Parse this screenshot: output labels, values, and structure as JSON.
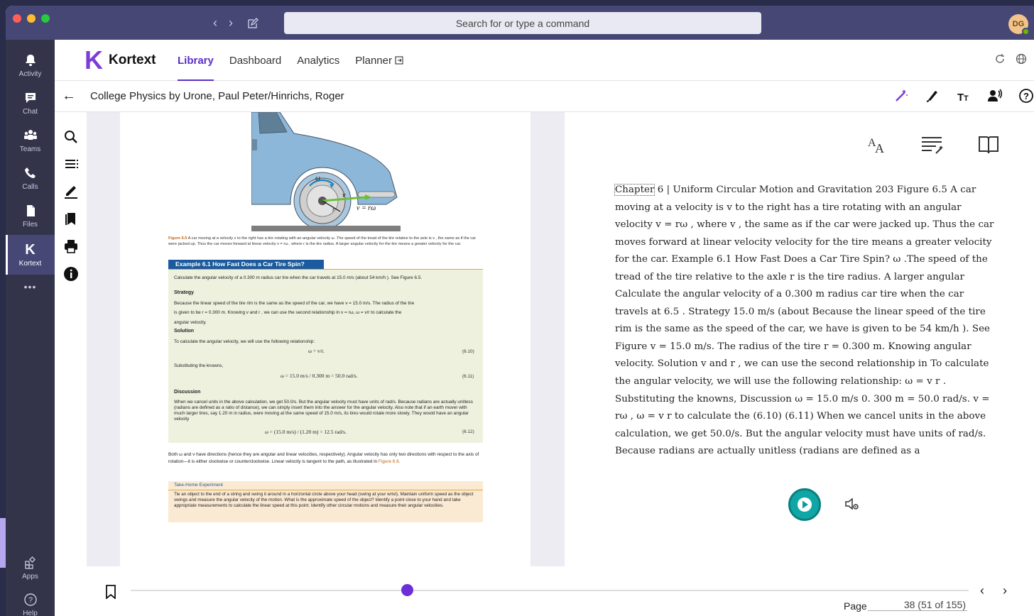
{
  "titlebar": {
    "search_placeholder": "Search for or type a command",
    "avatar_initials": "DG",
    "dot_colors": [
      "#ff5f57",
      "#ffbd2e",
      "#28c840"
    ]
  },
  "rail": {
    "items": [
      {
        "label": "Activity",
        "icon": "bell-icon"
      },
      {
        "label": "Chat",
        "icon": "chat-icon"
      },
      {
        "label": "Teams",
        "icon": "teams-icon"
      },
      {
        "label": "Calls",
        "icon": "phone-icon"
      },
      {
        "label": "Files",
        "icon": "file-icon"
      },
      {
        "label": "Kortext",
        "icon": "kortext-icon"
      }
    ],
    "more_label": "•••",
    "apps_label": "Apps",
    "help_label": "Help"
  },
  "header": {
    "logo_letter": "K",
    "logo_text": "Kortext",
    "tabs": [
      "Library",
      "Dashboard",
      "Analytics",
      "Planner"
    ],
    "active_tab": "Library"
  },
  "book": {
    "title": "College Physics by Urone, Paul Peter/Hinrichs, Roger"
  },
  "page": {
    "figure_label_omega": "ω",
    "figure_label_v": "v",
    "figure_label_r": "r",
    "figure_label_vrw": "v = rω",
    "caption_bold": "Figure 6.5",
    "caption_text": " A car moving at a velocity v to the right has a tire rotating with an angular velocity ω .The speed of the tread of the tire relative to the axle is v , the same as if the car were jacked up. Thus the car moves forward at linear velocity v = rω , where r is the tire radius. A larger angular velocity for the tire means a greater velocity for the car.",
    "example_title": "Example 6.1 How Fast Does a Car Tire Spin?",
    "example_intro": "Calculate the angular velocity of a 0.300 m radius car tire when the car travels at 15.0 m/s (about 54 km/h ). See Figure 6.5.",
    "strategy_head": "Strategy",
    "strategy_text_1": "Because the linear speed of the tire rim is the same as the speed of the car, we have v = 15.0 m/s. The radius of the tire",
    "strategy_text_2": "is given to be r = 0.300 m. Knowing v and r , we can use the second relationship in v = rω, ω = v/r to calculate the",
    "strategy_text_3": "angular velocity.",
    "solution_head": "Solution",
    "solution_text": "To calculate the angular velocity, we will use the following relationship:",
    "eq1": "ω = v/r.",
    "eq1_num": "(6.10)",
    "subst_text": "Substituting the knowns,",
    "eq2": "ω = 15.0 m/s / 0.300 m = 50.0 rad/s.",
    "eq2_num": "(6.11)",
    "discussion_head": "Discussion",
    "discussion_text": "When we cancel units in the above calculation, we get 50.0/s. But the angular velocity must have units of rad/s. Because radians are actually unitless (radians are defined as a ratio of distance), we can simply insert them into the answer for the angular velocity. Also note that if an earth mover with much larger tires, say 1.20 m in radius, were moving at the same speed of 15.0 m/s, its tires would rotate more slowly. They would have an angular velocity",
    "eq3": "ω = (15.0 m/s) / (1.20 m) = 12.5 rad/s.",
    "eq3_num": "(6.12)",
    "para2_text": "Both ω and v have directions (hence they are angular and linear velocities, respectively). Angular velocity has only two directions with respect to the axis of rotation—it is either clockwise or counterclockwise. Linear velocity is tangent to the path, as illustrated in ",
    "para2_link": "Figure 6.6.",
    "the_title": "Take-Home Experiment",
    "the_text": "Tie an object to the end of a string and swing it around in a horizontal circle above your head (swing at your wrist). Maintain uniform speed as the object swings and measure the angular velocity of the motion. What is the approximate speed of the object? Identify a point close to your hand and take appropriate measurements to calculate the linear speed at this point. Identify other circular motions and measure their angular velocities."
  },
  "reader": {
    "first_word": "Chapter",
    "text": " 6 | Uniform Circular Motion and Gravitation 203 Figure 6.5 A car moving at a velocity is v to the right has a tire rotating with an angular velocity v = rω , where v , the same as if the car were jacked up. Thus the car moves forward at linear velocity velocity for the tire means a greater velocity for the car. Example 6.1 How Fast Does a Car Tire Spin? ω .The speed of the tread of the tire relative to the axle r is the tire radius. A larger angular Calculate the angular velocity of a 0.300 m radius car tire when the car travels at 6.5 . Strategy 15.0 m/s (about Because the linear speed of the tire rim is the same as the speed of the car, we have is given to be 54 km/h ). See Figure v = 15.0 m/s. The radius of the tire r = 0.300 m. Knowing angular velocity. Solution v and r , we can use the second relationship in To calculate the angular velocity, we will use the following relationship: ω = v r . Substituting the knowns, Discussion ω = 15.0 m/s 0. 300 m = 50.0 rad/s. v = rω , ω = v r to calculate the (6.10) (6.11) When we cancel units in the above calculation, we get 50.0/s. But the angular velocity must have units of rad/s. Because radians are actually unitless (radians are defined as a"
  },
  "footer": {
    "page_label": "Page",
    "page_number": "38",
    "page_of": "(51 of 155)",
    "progress": 0.33
  }
}
